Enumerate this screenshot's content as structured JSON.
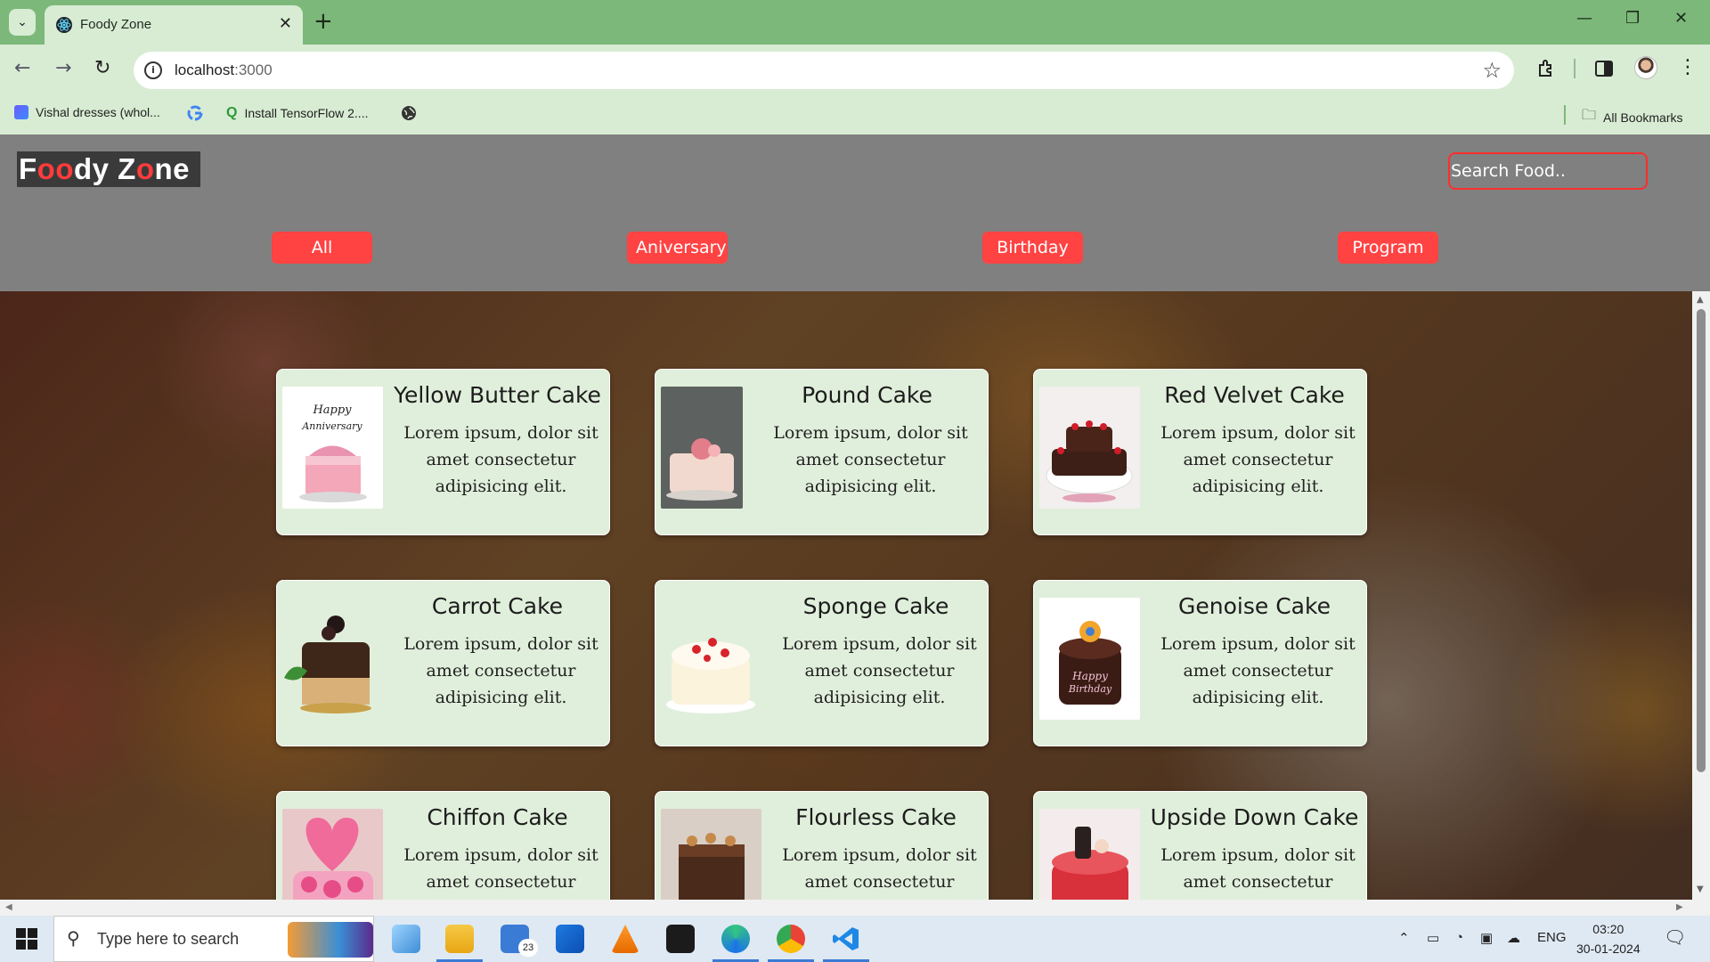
{
  "browser": {
    "tab_title": "Foody Zone",
    "url_host": "localhost",
    "url_port": ":3000",
    "bookmarks": [
      {
        "label": "Vishal dresses (whol..."
      },
      {
        "label": ""
      },
      {
        "label": "Install TensorFlow 2...."
      },
      {
        "label": ""
      }
    ],
    "all_bookmarks_label": "All Bookmarks"
  },
  "app": {
    "logo_parts": [
      "F",
      "oo",
      "dy Z",
      "o",
      "ne"
    ],
    "search_placeholder": "Search Food..",
    "filters": [
      {
        "label": "All"
      },
      {
        "label": "Aniversary"
      },
      {
        "label": "Birthday"
      },
      {
        "label": "Program"
      }
    ],
    "cards": [
      {
        "name": "Yellow Butter Cake",
        "desc": "Lorem ipsum, dolor sit amet consectetur adipisicing elit."
      },
      {
        "name": "Pound Cake",
        "desc": "Lorem ipsum, dolor sit amet consectetur adipisicing elit."
      },
      {
        "name": "Red Velvet Cake",
        "desc": "Lorem ipsum, dolor sit amet consectetur adipisicing elit."
      },
      {
        "name": "Carrot Cake",
        "desc": "Lorem ipsum, dolor sit amet consectetur adipisicing elit."
      },
      {
        "name": "Sponge Cake",
        "desc": "Lorem ipsum, dolor sit amet consectetur adipisicing elit."
      },
      {
        "name": "Genoise Cake",
        "desc": "Lorem ipsum, dolor sit amet consectetur adipisicing elit."
      },
      {
        "name": "Chiffon Cake",
        "desc": "Lorem ipsum, dolor sit amet consectetur"
      },
      {
        "name": "Flourless Cake",
        "desc": "Lorem ipsum, dolor sit amet consectetur"
      },
      {
        "name": "Upside Down Cake",
        "desc": "Lorem ipsum, dolor sit amet consectetur"
      }
    ],
    "colors": {
      "accent": "#ff4343",
      "card_bg": "#e0efdb",
      "header_bg": "#808080"
    }
  },
  "taskbar": {
    "search_placeholder": "Type here to search",
    "mail_badge": "23",
    "language": "ENG",
    "time": "03:20",
    "date": "30-01-2024"
  }
}
